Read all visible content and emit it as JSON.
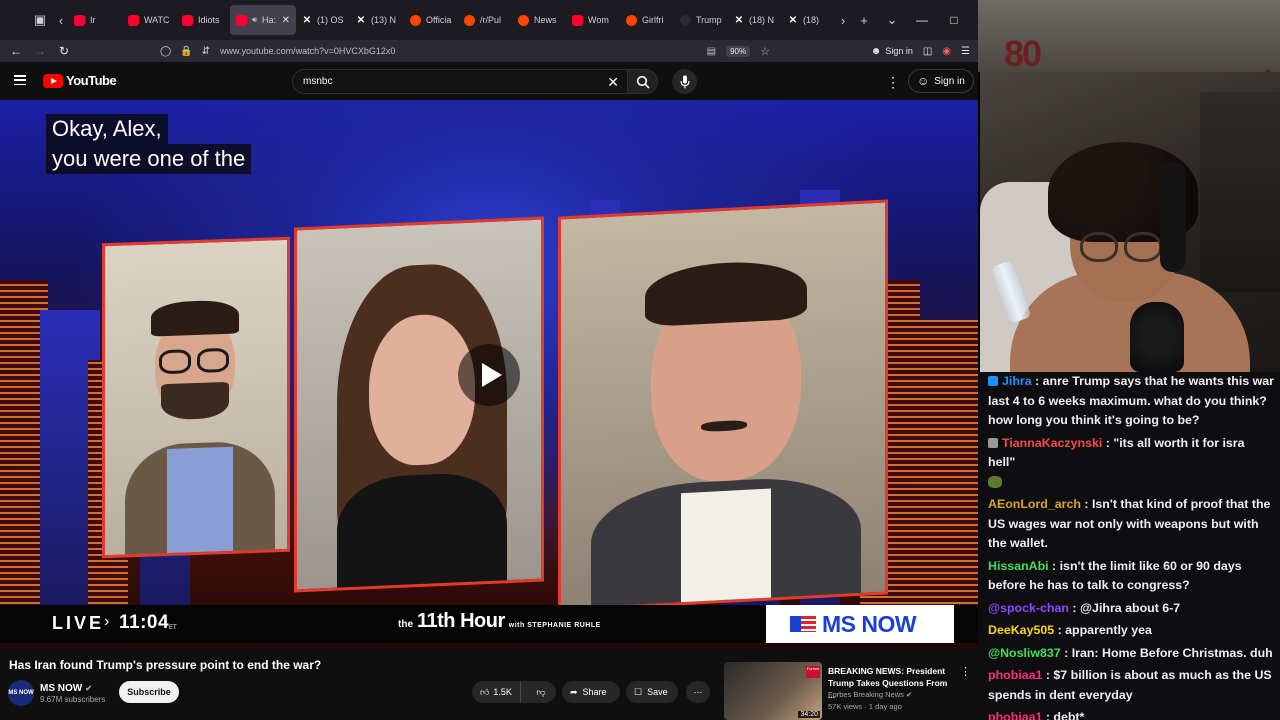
{
  "browser": {
    "tabs": [
      {
        "label": "Ir",
        "icon": "youtube-icon",
        "active": false
      },
      {
        "label": "WATC",
        "icon": "youtube-icon",
        "active": false
      },
      {
        "label": "Idiots",
        "icon": "youtube-icon",
        "active": false
      },
      {
        "label": "Ha:",
        "icon": "youtube-icon",
        "active": true
      },
      {
        "label": "(1) OS",
        "icon": "x-icon",
        "active": false
      },
      {
        "label": "(13) N",
        "icon": "x-icon",
        "active": false
      },
      {
        "label": "Officia",
        "icon": "reddit-icon",
        "active": false
      },
      {
        "label": "/r/Pul",
        "icon": "reddit-icon",
        "active": false
      },
      {
        "label": "News",
        "icon": "reddit-icon",
        "active": false
      },
      {
        "label": "Wom",
        "icon": "youtube-icon",
        "active": false
      },
      {
        "label": "Girlfri",
        "icon": "reddit-icon",
        "active": false
      },
      {
        "label": "Trump",
        "icon": "site-icon",
        "active": false
      },
      {
        "label": "(18) N",
        "icon": "x-icon",
        "active": false
      },
      {
        "label": "(18)",
        "icon": "x-icon",
        "active": false
      }
    ],
    "url": "www.youtube.com/watch?v=0HVCXbG12x0",
    "zoom": "90%",
    "signin_label": "Sign in"
  },
  "youtube": {
    "logo_text": "YouTube",
    "search_value": "msnbc",
    "signin_label": "Sign in"
  },
  "video": {
    "caption_line1": "Okay, Alex,",
    "caption_line2": "you were one of the",
    "live_label": "LIVE",
    "live_time": "11:04",
    "live_tz": "ET",
    "show_the": "the",
    "show_name": "11th Hour",
    "show_with": "with STEPHANIE RUHLE",
    "network": "MS NOW"
  },
  "details": {
    "title": "Has Iran found Trump's pressure point to end the war?",
    "channel_name": "MS NOW",
    "channel_avatar_text": "MS NOW",
    "subscribers": "9.67M subscribers",
    "subscribe_label": "Subscribe",
    "likes": "1.5K",
    "share_label": "Share",
    "save_label": "Save"
  },
  "related": {
    "title": "BREAKING NEWS: President Trump Takes Questions From ...",
    "channel": "Forbes Breaking News",
    "meta": "57K views · 1 day ago",
    "duration": "34:20",
    "badge": "Forbes"
  },
  "stream": {
    "overlay_number": "80"
  },
  "chat": [
    {
      "user": "Jihra",
      "color": "#1e90ff",
      "badge": "#1e90ff",
      "text": "anre Trump says that he wants this war last 4 to 6 weeks maximum. what do you think? how long you think it's going to be?"
    },
    {
      "user": "TiannaKaczynski",
      "color": "#ff4a3a",
      "badge": "#999999",
      "text": "\"its all worth it for isra hell\"",
      "emote": true
    },
    {
      "user": "AEonLord_arch",
      "color": "#daa520",
      "badge": null,
      "text": "Isn't that kind of proof that the US wages war not only with weapons but with the wallet."
    },
    {
      "user": "HissanAbi",
      "color": "#3ee05a",
      "badge": null,
      "text": "isn't the limit like 60 or 90 days before he has to talk to congress?"
    },
    {
      "user": "@spock-chan",
      "color": "#9147ff",
      "badge": null,
      "text": "@Jihra about 6-7"
    },
    {
      "user": "DeeKay505",
      "color": "#ffd700",
      "badge": null,
      "text": "apparently yea"
    },
    {
      "user": "@Nosliw837",
      "color": "#3ee05a",
      "badge": null,
      "text": "Iran: Home Before Christmas. duh"
    },
    {
      "user": "phobiaa1",
      "color": "#ff2d7a",
      "badge": null,
      "text": "$7 billion is about as much as the US spends in dent everyday"
    },
    {
      "user": "phobiaa1",
      "color": "#ff2d7a",
      "badge": null,
      "text": "debt*"
    }
  ]
}
